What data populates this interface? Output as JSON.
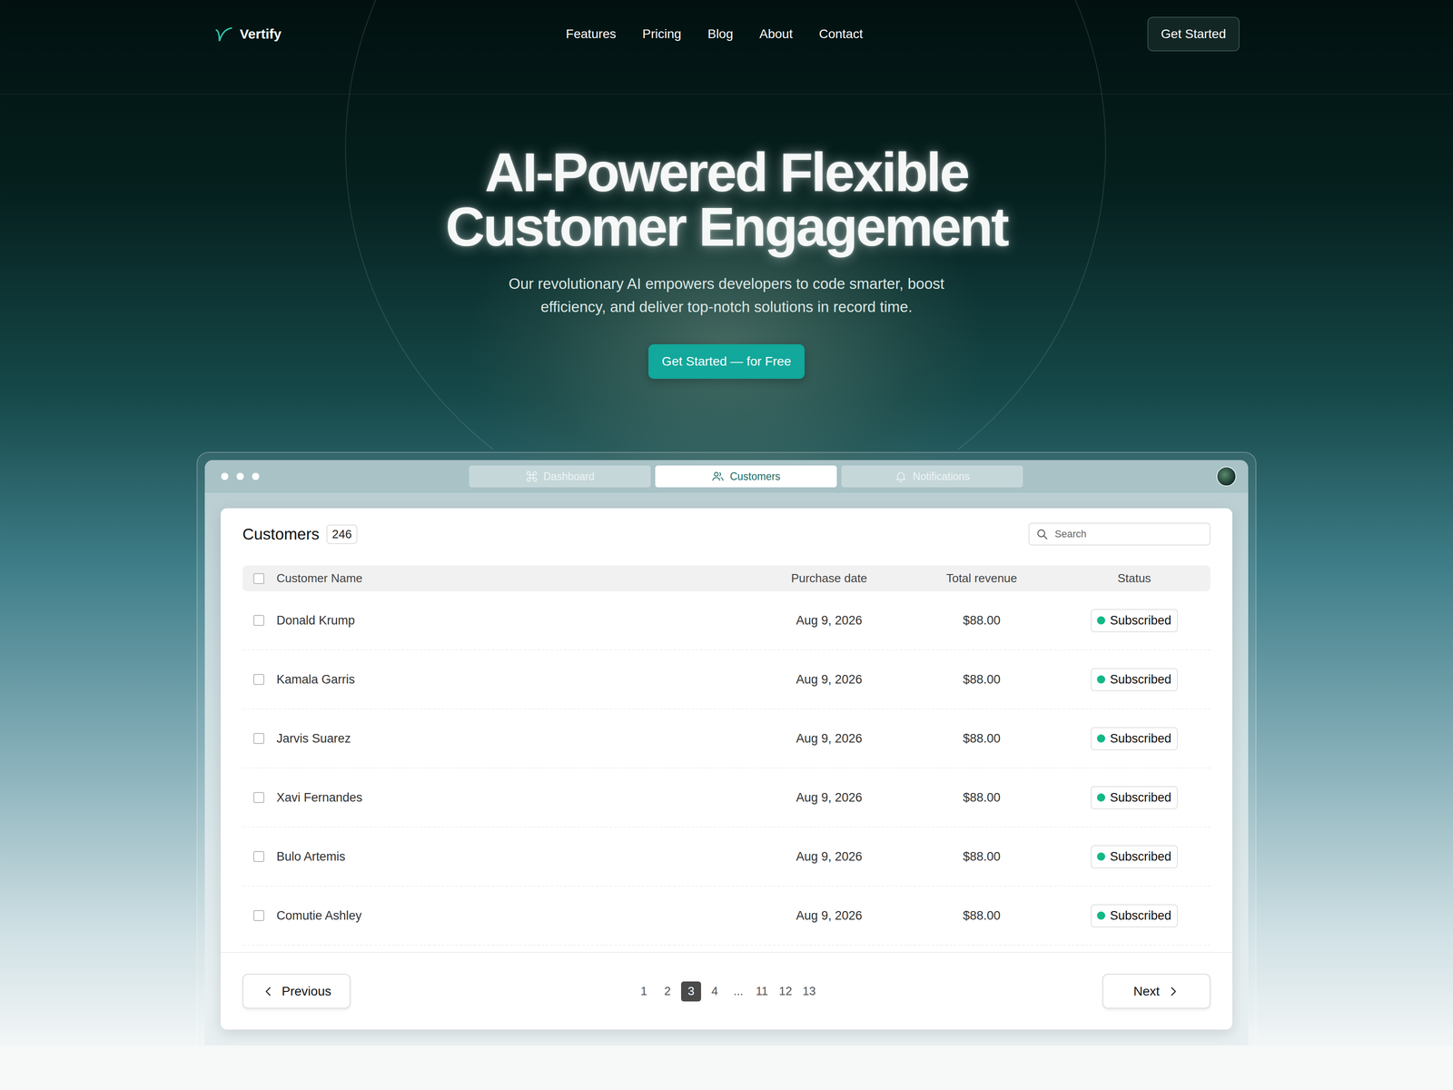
{
  "brand": {
    "name": "Vertify"
  },
  "nav": [
    {
      "label": "Features"
    },
    {
      "label": "Pricing"
    },
    {
      "label": "Blog"
    },
    {
      "label": "About"
    },
    {
      "label": "Contact"
    }
  ],
  "header_button": "Get Started",
  "hero": {
    "title_lines": [
      "AI-Powered Flexible",
      "Customer Engagement"
    ],
    "subtitle_lines": [
      "Our revolutionary AI empowers developers to code smarter, boost",
      "efficiency, and deliver top-notch solutions in record time."
    ],
    "cta": "Get Started — for Free"
  },
  "app_window": {
    "tabs": [
      {
        "label": "Dashboard",
        "selected": false
      },
      {
        "label": "Customers",
        "selected": true
      },
      {
        "label": "Notifications",
        "selected": false
      }
    ]
  },
  "table": {
    "title": "Customers",
    "count": "246",
    "search_placeholder": "Search",
    "select_all_checked": false,
    "columns": [
      "Customer Name",
      "Purchase date",
      "Total revenue",
      "Status"
    ],
    "rows": [
      {
        "name": "Donald Krump",
        "date": "Aug 9, 2026",
        "revenue": "$88.00",
        "status": "Subscribed",
        "checked": false,
        "color": "#12b886"
      },
      {
        "name": "Kamala Garris",
        "date": "Aug 9, 2026",
        "revenue": "$88.00",
        "status": "Subscribed",
        "checked": false,
        "color": "#12b886"
      },
      {
        "name": "Jarvis Suarez",
        "date": "Aug 9, 2026",
        "revenue": "$88.00",
        "status": "Subscribed",
        "checked": false,
        "color": "#12b886"
      },
      {
        "name": "Xavi Fernandes",
        "date": "Aug 9, 2026",
        "revenue": "$88.00",
        "status": "Subscribed",
        "checked": false,
        "color": "#12b886"
      },
      {
        "name": "Bulo Artemis",
        "date": "Aug 9, 2026",
        "revenue": "$88.00",
        "status": "Subscribed",
        "checked": false,
        "color": "#12b886"
      },
      {
        "name": "Comutie Ashley",
        "date": "Aug 9, 2026",
        "revenue": "$88.00",
        "status": "Subscribed",
        "checked": false,
        "color": "#12b886"
      }
    ]
  },
  "pagination": {
    "previous": "Previous",
    "next": "Next",
    "pages": [
      {
        "label": "1",
        "selected": false
      },
      {
        "label": "2",
        "selected": false
      },
      {
        "label": "3",
        "selected": true
      },
      {
        "label": "4",
        "selected": false
      },
      {
        "label": "...",
        "selected": false
      },
      {
        "label": "11",
        "selected": false
      },
      {
        "label": "12",
        "selected": false
      },
      {
        "label": "13",
        "selected": false
      }
    ]
  }
}
